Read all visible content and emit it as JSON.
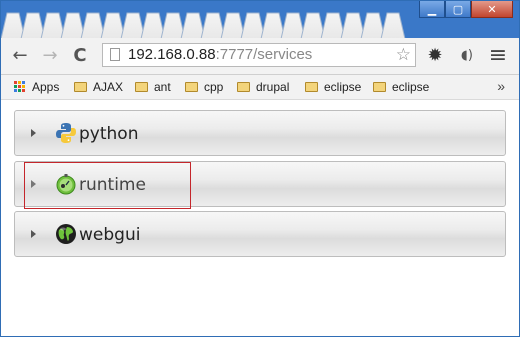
{
  "browser": {
    "window_controls": {
      "minimize": "▁",
      "maximize": "▢",
      "close": "✕"
    },
    "toolbar": {
      "back_icon": "←",
      "forward_icon": "→",
      "reload_icon": "C",
      "url_host": "192.168.0.88",
      "url_rest": ":7777/services",
      "star_icon": "☆",
      "settings_icon": "✹",
      "speaker_icon": "◖)",
      "menu_icon": "≡"
    },
    "bookmarks": {
      "apps_label": "Apps",
      "items": [
        {
          "label": "AJAX"
        },
        {
          "label": "ant"
        },
        {
          "label": "cpp"
        },
        {
          "label": "drupal"
        },
        {
          "label": "eclipse"
        },
        {
          "label": "eclipse"
        }
      ],
      "overflow": "»"
    }
  },
  "services": [
    {
      "name": "python",
      "icon": "python-icon"
    },
    {
      "name": "runtime",
      "icon": "runtime-icon"
    },
    {
      "name": "webgui",
      "icon": "globe-icon"
    }
  ],
  "colors": {
    "frame": "#3a78c8",
    "highlight_border": "#c4262b"
  }
}
